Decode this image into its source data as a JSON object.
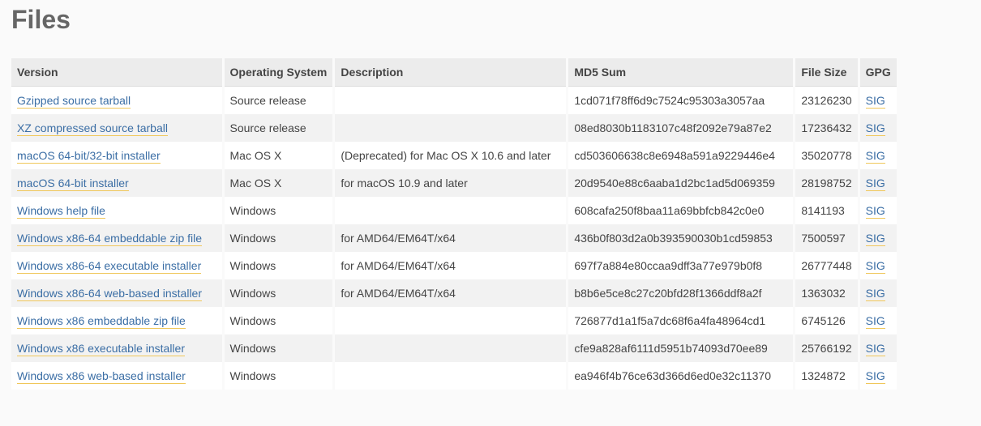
{
  "page": {
    "title": "Files"
  },
  "table": {
    "headers": {
      "version": "Version",
      "os": "Operating System",
      "description": "Description",
      "md5": "MD5 Sum",
      "size": "File Size",
      "gpg": "GPG"
    },
    "rows": [
      {
        "version": "Gzipped source tarball",
        "os": "Source release",
        "description": "",
        "md5": "1cd071f78ff6d9c7524c95303a3057aa",
        "size": "23126230",
        "gpg": "SIG"
      },
      {
        "version": "XZ compressed source tarball",
        "os": "Source release",
        "description": "",
        "md5": "08ed8030b1183107c48f2092e79a87e2",
        "size": "17236432",
        "gpg": "SIG"
      },
      {
        "version": "macOS 64-bit/32-bit installer",
        "os": "Mac OS X",
        "description": "(Deprecated) for Mac OS X 10.6 and later",
        "md5": "cd503606638c8e6948a591a9229446e4",
        "size": "35020778",
        "gpg": "SIG"
      },
      {
        "version": "macOS 64-bit installer",
        "os": "Mac OS X",
        "description": "for macOS 10.9 and later",
        "md5": "20d9540e88c6aaba1d2bc1ad5d069359",
        "size": "28198752",
        "gpg": "SIG"
      },
      {
        "version": "Windows help file",
        "os": "Windows",
        "description": "",
        "md5": "608cafa250f8baa11a69bbfcb842c0e0",
        "size": "8141193",
        "gpg": "SIG"
      },
      {
        "version": "Windows x86-64 embeddable zip file",
        "os": "Windows",
        "description": "for AMD64/EM64T/x64",
        "md5": "436b0f803d2a0b393590030b1cd59853",
        "size": "7500597",
        "gpg": "SIG"
      },
      {
        "version": "Windows x86-64 executable installer",
        "os": "Windows",
        "description": "for AMD64/EM64T/x64",
        "md5": "697f7a884e80ccaa9dff3a77e979b0f8",
        "size": "26777448",
        "gpg": "SIG"
      },
      {
        "version": "Windows x86-64 web-based installer",
        "os": "Windows",
        "description": "for AMD64/EM64T/x64",
        "md5": "b8b6e5ce8c27c20bfd28f1366ddf8a2f",
        "size": "1363032",
        "gpg": "SIG"
      },
      {
        "version": "Windows x86 embeddable zip file",
        "os": "Windows",
        "description": "",
        "md5": "726877d1a1f5a7dc68f6a4fa48964cd1",
        "size": "6745126",
        "gpg": "SIG"
      },
      {
        "version": "Windows x86 executable installer",
        "os": "Windows",
        "description": "",
        "md5": "cfe9a828af6111d5951b74093d70ee89",
        "size": "25766192",
        "gpg": "SIG"
      },
      {
        "version": "Windows x86 web-based installer",
        "os": "Windows",
        "description": "",
        "md5": "ea946f4b76ce63d366d6ed0e32c11370",
        "size": "1324872",
        "gpg": "SIG"
      }
    ]
  },
  "colors": {
    "link": "#3b6ea5",
    "link_underline": "#f0c75a",
    "header_bg": "#ececec",
    "row_alt_bg": "#f2f2f2"
  }
}
